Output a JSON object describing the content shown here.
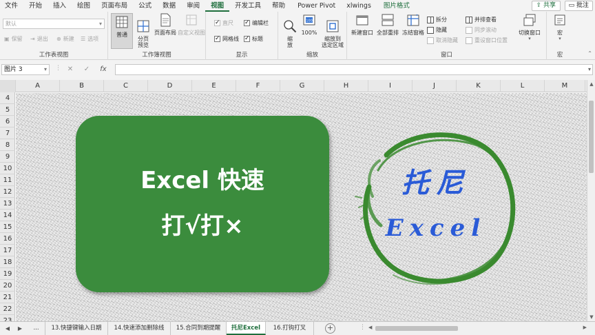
{
  "menu": {
    "items": [
      "文件",
      "开始",
      "插入",
      "绘图",
      "页面布局",
      "公式",
      "数据",
      "审阅",
      "视图",
      "开发工具",
      "帮助",
      "Power Pivot",
      "xlwings"
    ],
    "context_tab": "图片格式",
    "active_index": 8,
    "share_label": "共享",
    "comment_label": "批注"
  },
  "ribbon": {
    "sheet_view": {
      "select_value": "默认",
      "keep": "保留",
      "exit": "退出",
      "new": "新建",
      "options": "选项",
      "label": "工作表视图"
    },
    "workbook_views": {
      "normal": "普通",
      "page_break": "分页\n预览",
      "page_layout": "页面布局",
      "custom": "自定义视图",
      "label": "工作簿视图"
    },
    "show": {
      "ruler": "直尺",
      "formula_bar": "编辑栏",
      "gridlines": "网格线",
      "headings": "标题",
      "label": "显示"
    },
    "zoom": {
      "zoom": "缩\n放",
      "zoom100": "100%",
      "zoom_selection": "缩放到\n选定区域",
      "label": "缩放"
    },
    "window": {
      "new_window": "新建窗口",
      "arrange_all": "全部重排",
      "freeze": "冻结窗格",
      "split": "拆分",
      "hide": "隐藏",
      "unhide": "取消隐藏",
      "side_by_side": "并排查看",
      "sync_scroll": "同步滚动",
      "reset_position": "重设窗口位置",
      "switch_windows": "切换窗口",
      "label": "窗口"
    },
    "macros": {
      "macros": "宏",
      "label": "宏"
    }
  },
  "formula_bar": {
    "name_box": "图片 3",
    "cancel": "✕",
    "enter": "✓",
    "fx": "fx",
    "content": ""
  },
  "grid": {
    "columns": [
      "A",
      "B",
      "C",
      "D",
      "E",
      "F",
      "G",
      "H",
      "I",
      "J",
      "K",
      "L",
      "M"
    ],
    "rows": [
      "4",
      "5",
      "6",
      "7",
      "8",
      "9",
      "10",
      "11",
      "12",
      "13",
      "14",
      "15",
      "16",
      "17",
      "18",
      "19",
      "20",
      "21",
      "22",
      "23"
    ]
  },
  "content": {
    "card_line1": "Excel 快速",
    "card_line2": "打√打×",
    "logo_text1": "托尼",
    "logo_text2": "Excel"
  },
  "sheet_tabs": {
    "ellipsis": "...",
    "tabs": [
      "13.快捷键输入日期",
      "14.快速添加删除线",
      "15.合同到期提醒",
      "托尼Excel",
      "16.打钩打叉"
    ],
    "active_index": 3
  },
  "colors": {
    "excel_green": "#1e6e3c",
    "card_green": "#3b8c3d",
    "logo_blue": "#2a5bd7",
    "logo_green": "#3a8a2f"
  }
}
